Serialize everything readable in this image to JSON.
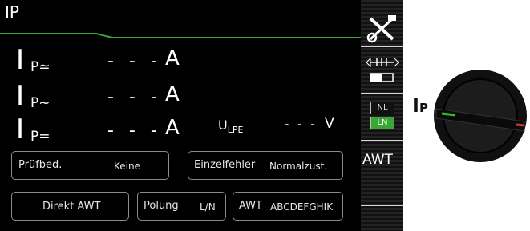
{
  "header": {
    "title": "IP"
  },
  "measurements": [
    {
      "symbol": "I",
      "subscript": "P≃",
      "value": "- - -",
      "unit": "A"
    },
    {
      "symbol": "I",
      "subscript": "P~",
      "value": "- - -",
      "unit": "A"
    },
    {
      "symbol": "I",
      "subscript": "P=",
      "value": "- - -",
      "unit": "A"
    }
  ],
  "ulpe": {
    "symbol": "U",
    "subscript": "LPE",
    "value": "- - -",
    "unit": "V"
  },
  "params": {
    "pruefbed": {
      "label": "Prüfbed.",
      "value": "Keine"
    },
    "einzelfehler": {
      "label": "Einzelfehler",
      "value": "Normalzust."
    },
    "direkt": {
      "label": "Direkt AWT"
    },
    "polung": {
      "label": "Polung",
      "value": "L/N"
    },
    "awt": {
      "label": "AWT",
      "value": "ABCDEFGHIK"
    }
  },
  "sidebar": {
    "nl": "NL",
    "ln": "LN",
    "awt": "AWT"
  },
  "dial": {
    "label": "I",
    "subscript": "P"
  },
  "colors": {
    "accent_green": "#3aa636",
    "knob_green": "#2fbf2f",
    "knob_red": "#c8402a"
  },
  "icons": [
    "tools-icon",
    "probe-connection-icon",
    "rotary-knob-icon"
  ]
}
